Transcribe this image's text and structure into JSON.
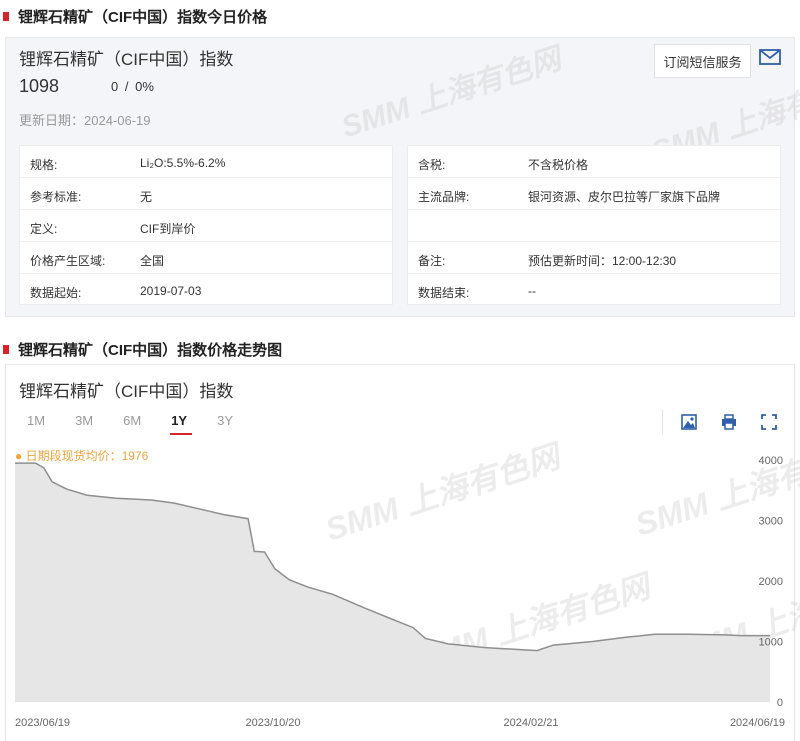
{
  "section1": {
    "title": "锂辉石精矿（CIF中国）指数今日价格"
  },
  "product": {
    "name": "锂辉石精矿（CIF中国）指数",
    "price": "1098",
    "change": "0",
    "change_sep": "/",
    "change_pct": "0%",
    "update_label": "更新日期：",
    "update_date": "2024-06-19",
    "sms_label": "订阅短信服务"
  },
  "info_left": [
    {
      "label": "规格:",
      "value": "Li₂O:5.5%-6.2%"
    },
    {
      "label": "参考标准:",
      "value": "无"
    },
    {
      "label": "定义:",
      "value": "CIF到岸价"
    },
    {
      "label": "价格产生区域:",
      "value": "全国"
    },
    {
      "label": "数据起始:",
      "value": "2019-07-03"
    }
  ],
  "info_right": [
    {
      "label": "含税:",
      "value": "不含税价格"
    },
    {
      "label": "主流品牌:",
      "value": "银河资源、皮尔巴拉等厂家旗下品牌"
    },
    {
      "label": "",
      "value": ""
    },
    {
      "label": "备注:",
      "value": "预估更新时间：12:00-12:30"
    },
    {
      "label": "数据结束:",
      "value": "--"
    }
  ],
  "section2": {
    "title": "锂辉石精矿（CIF中国）指数价格走势图"
  },
  "chart_panel": {
    "title": "锂辉石精矿（CIF中国）指数",
    "tabs": [
      "1M",
      "3M",
      "6M",
      "1Y",
      "3Y"
    ],
    "active_tab": "1Y",
    "avg_label": "● 日期段现货均价：1976"
  },
  "watermark": "SMM 上海有色网",
  "colors": {
    "accent": "#d9232c",
    "avg": "#f0a33d",
    "line": "#8e8e8e",
    "fill": "#e6e6e6"
  },
  "chart_data": {
    "type": "area",
    "title": "锂辉石精矿（CIF中国）指数",
    "xlabel": "",
    "ylabel": "",
    "x_ticks": [
      "2023/06/19",
      "2023/10/20",
      "2024/02/21",
      "2024/06/19"
    ],
    "y_ticks": [
      0,
      1000,
      2000,
      3000,
      4000
    ],
    "ylim": [
      0,
      4150
    ],
    "xlim": [
      "2023-06-19",
      "2024-06-19"
    ],
    "grid": false,
    "series": [
      {
        "values": [
          [
            "2023-06-19",
            3950
          ],
          [
            "2023-06-29",
            3950
          ],
          [
            "2023-07-03",
            3870
          ],
          [
            "2023-07-07",
            3640
          ],
          [
            "2023-07-14",
            3520
          ],
          [
            "2023-07-24",
            3420
          ],
          [
            "2023-08-07",
            3370
          ],
          [
            "2023-08-24",
            3340
          ],
          [
            "2023-09-04",
            3290
          ],
          [
            "2023-09-18",
            3180
          ],
          [
            "2023-09-28",
            3100
          ],
          [
            "2023-10-10",
            3030
          ],
          [
            "2023-10-13",
            2490
          ],
          [
            "2023-10-18",
            2480
          ],
          [
            "2023-10-23",
            2200
          ],
          [
            "2023-10-30",
            2020
          ],
          [
            "2023-11-08",
            1900
          ],
          [
            "2023-11-20",
            1780
          ],
          [
            "2023-12-05",
            1560
          ],
          [
            "2023-12-18",
            1380
          ],
          [
            "2023-12-29",
            1230
          ],
          [
            "2024-01-04",
            1050
          ],
          [
            "2024-01-15",
            960
          ],
          [
            "2024-02-02",
            900
          ],
          [
            "2024-02-27",
            850
          ],
          [
            "2024-03-06",
            940
          ],
          [
            "2024-03-25",
            1000
          ],
          [
            "2024-04-10",
            1070
          ],
          [
            "2024-04-24",
            1120
          ],
          [
            "2024-05-10",
            1120
          ],
          [
            "2024-05-28",
            1110
          ],
          [
            "2024-06-05",
            1098
          ],
          [
            "2024-06-19",
            1098
          ]
        ]
      }
    ]
  }
}
